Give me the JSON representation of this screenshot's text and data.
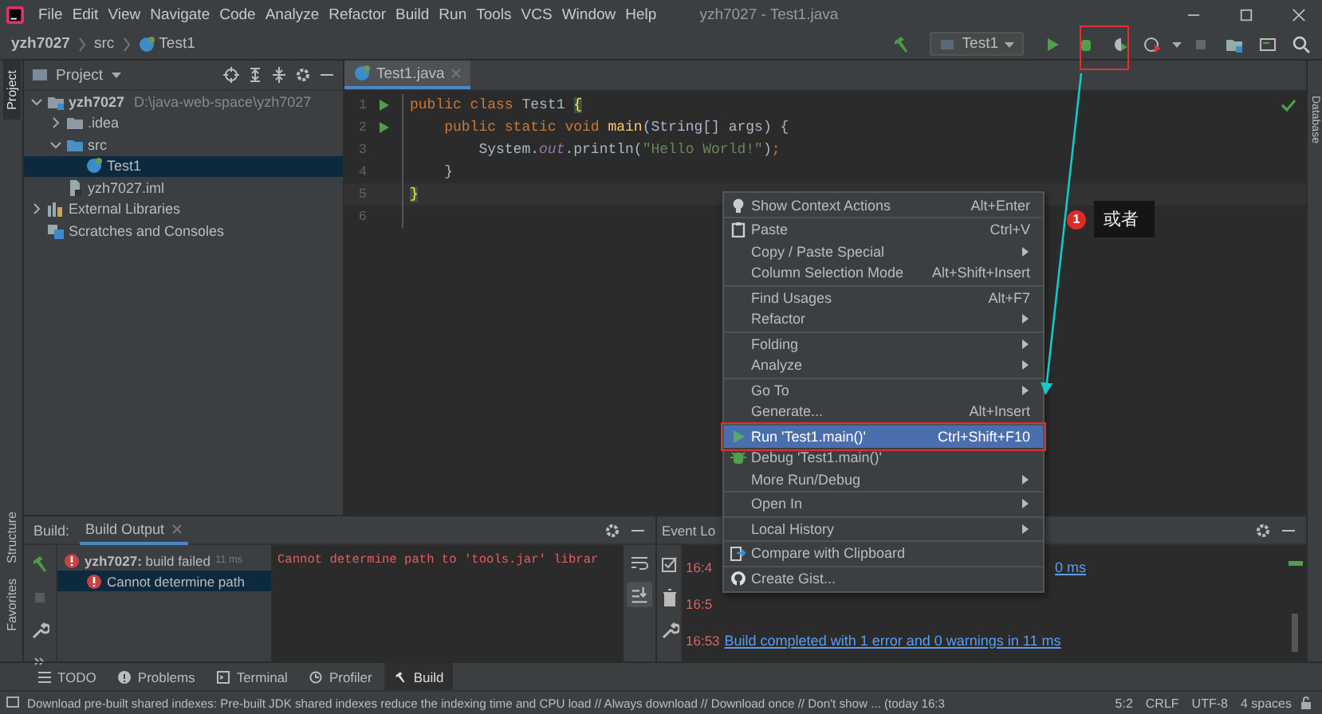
{
  "window": {
    "title": "yzh7027 - Test1.java"
  },
  "menu_bar": [
    "File",
    "Edit",
    "View",
    "Navigate",
    "Code",
    "Analyze",
    "Refactor",
    "Build",
    "Run",
    "Tools",
    "VCS",
    "Window",
    "Help"
  ],
  "breadcrumbs": [
    "yzh7027",
    "src",
    "Test1"
  ],
  "run_config": {
    "label": "Test1"
  },
  "tool_strips": {
    "left_top": [
      {
        "label": "Project",
        "selected": true
      }
    ],
    "left_bottom": [
      {
        "label": "Structure",
        "selected": false
      },
      {
        "label": "Favorites",
        "selected": false
      }
    ],
    "right": [
      {
        "label": "Database",
        "selected": false
      }
    ]
  },
  "project_panel": {
    "title": "Project",
    "tree": [
      {
        "label": "yzh7027",
        "path": "D:\\java-web-space\\yzh7027",
        "kind": "module",
        "expanded": true,
        "selected": false,
        "children": [
          {
            "label": ".idea",
            "kind": "folder",
            "expanded": false,
            "selected": false
          },
          {
            "label": "src",
            "kind": "source",
            "expanded": true,
            "selected": false,
            "children": [
              {
                "label": "Test1",
                "kind": "class",
                "selected": true
              }
            ]
          },
          {
            "label": "yzh7027.iml",
            "kind": "file",
            "selected": false
          }
        ]
      },
      {
        "label": "External Libraries",
        "kind": "libraries",
        "expanded": false,
        "selected": false
      },
      {
        "label": "Scratches and Consoles",
        "kind": "scratches",
        "selected": false
      }
    ]
  },
  "editor": {
    "tabs": [
      {
        "label": "Test1.java",
        "selected": true
      }
    ],
    "lines": [
      {
        "number": "1",
        "run": true,
        "current": false,
        "tokens": [
          {
            "kind": "keyword",
            "text": "public class "
          },
          {
            "kind": "plain",
            "text": "Test1 "
          },
          {
            "kind": "match",
            "text": "{"
          }
        ]
      },
      {
        "number": "2",
        "run": true,
        "current": false,
        "tokens": [
          {
            "kind": "keyword",
            "text": "    public static void "
          },
          {
            "kind": "method",
            "text": "main"
          },
          {
            "kind": "plain",
            "text": "(String[] args) {"
          }
        ]
      },
      {
        "number": "3",
        "run": false,
        "current": false,
        "tokens": [
          {
            "kind": "plain",
            "text": "        System."
          },
          {
            "kind": "field",
            "text": "out"
          },
          {
            "kind": "plain",
            "text": ".println("
          },
          {
            "kind": "string",
            "text": "\"Hello World!\""
          },
          {
            "kind": "plain",
            "text": ")"
          },
          {
            "kind": "keyword",
            "text": ";"
          }
        ]
      },
      {
        "number": "4",
        "run": false,
        "current": false,
        "tokens": [
          {
            "kind": "plain",
            "text": "    }"
          }
        ]
      },
      {
        "number": "5",
        "run": false,
        "current": true,
        "tokens": [
          {
            "kind": "match",
            "text": "}"
          }
        ]
      },
      {
        "number": "6",
        "run": false,
        "current": false
      }
    ]
  },
  "context_menu": [
    {
      "kind": "item",
      "label": "Show Context Actions",
      "shortcut": "Alt+Enter",
      "selected": false
    },
    {
      "kind": "separator"
    },
    {
      "kind": "item",
      "label": "Paste",
      "shortcut": "Ctrl+V",
      "selected": false
    },
    {
      "kind": "submenu",
      "label": "Copy / Paste Special",
      "selected": false
    },
    {
      "kind": "item",
      "label": "Column Selection Mode",
      "shortcut": "Alt+Shift+Insert",
      "selected": false
    },
    {
      "kind": "separator"
    },
    {
      "kind": "item",
      "label": "Find Usages",
      "shortcut": "Alt+F7",
      "selected": false
    },
    {
      "kind": "submenu",
      "label": "Refactor",
      "selected": false
    },
    {
      "kind": "separator"
    },
    {
      "kind": "submenu",
      "label": "Folding",
      "selected": false
    },
    {
      "kind": "submenu",
      "label": "Analyze",
      "selected": false
    },
    {
      "kind": "separator"
    },
    {
      "kind": "submenu",
      "label": "Go To",
      "selected": false
    },
    {
      "kind": "item",
      "label": "Generate...",
      "shortcut": "Alt+Insert",
      "selected": false
    },
    {
      "kind": "separator"
    },
    {
      "kind": "item",
      "label": "Run 'Test1.main()'",
      "shortcut": "Ctrl+Shift+F10",
      "selected": true
    },
    {
      "kind": "item",
      "label": "Debug 'Test1.main()'",
      "selected": false
    },
    {
      "kind": "submenu",
      "label": "More Run/Debug",
      "selected": false
    },
    {
      "kind": "separator"
    },
    {
      "kind": "submenu",
      "label": "Open In",
      "selected": false
    },
    {
      "kind": "separator"
    },
    {
      "kind": "submenu",
      "label": "Local History",
      "selected": false
    },
    {
      "kind": "separator"
    },
    {
      "kind": "item",
      "label": "Compare with Clipboard",
      "selected": false
    },
    {
      "kind": "separator"
    },
    {
      "kind": "item",
      "label": "Create Gist...",
      "selected": false
    }
  ],
  "annotation": {
    "badge": "1",
    "note": "或者"
  },
  "build_panel": {
    "title": "Build:",
    "tabs": [
      {
        "label": "Build Output",
        "selected": true
      }
    ],
    "tree": [
      {
        "label": "**yzh7027:** build failed",
        "time": "11 ms",
        "selected": false,
        "children": [
          {
            "label": "Cannot determine path",
            "selected": true
          }
        ]
      }
    ],
    "output": "Cannot determine path to 'tools.jar' librar"
  },
  "event_log": {
    "title": "Event Lo",
    "entries": [
      {
        "kind": "partial",
        "time": "16:4",
        "message": "0 ms"
      },
      {
        "kind": "partial",
        "time": "16:5"
      },
      {
        "kind": "full",
        "time": "16:53",
        "message": "Build completed with 1 error and 0 warnings in 11 ms"
      }
    ]
  },
  "bottom_tabs": [
    {
      "label": "TODO",
      "selected": false
    },
    {
      "label": "Problems",
      "selected": false
    },
    {
      "label": "Terminal",
      "selected": false
    },
    {
      "label": "Profiler",
      "selected": false
    },
    {
      "label": "Build",
      "selected": true
    }
  ],
  "status_bar": {
    "message": "Download pre-built shared indexes: Pre-built JDK shared indexes reduce the indexing time and CPU load // Always download // Download once // Don't show ... (today 16:3",
    "position": "5:2",
    "line_separator": "CRLF",
    "encoding": "UTF-8",
    "indent": "4 spaces"
  }
}
